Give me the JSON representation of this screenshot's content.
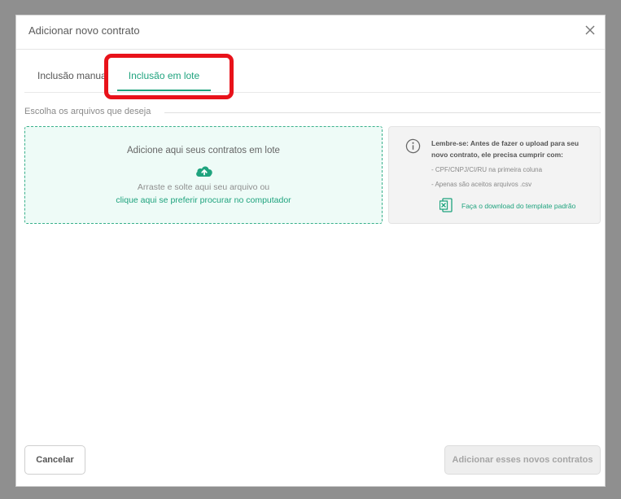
{
  "modal": {
    "title": "Adicionar novo contrato"
  },
  "tabs": [
    {
      "label": "Inclusão manual",
      "active": false
    },
    {
      "label": "Inclusão em lote",
      "active": true
    }
  ],
  "section": {
    "label": "Escolha os arquivos que deseja"
  },
  "dropzone": {
    "title": "Adicione aqui seus contratos em lote",
    "icon": "cloud-upload-icon",
    "subtitle": "Arraste e solte aqui seu arquivo ou",
    "link": "clique aqui se preferir procurar no computador"
  },
  "info": {
    "icon": "info-icon",
    "text": "Lembre-se: Antes de fazer o upload para seu novo contrato, ele precisa cumprir com:",
    "items": [
      "- CPF/CNPJ/CI/RU na primeira coluna",
      "- Apenas são aceitos arquivos .csv"
    ],
    "download_icon": "excel-icon",
    "download_link": "Faça o download do template padrão"
  },
  "footer": {
    "cancel_label": "Cancelar",
    "submit_label": "Adicionar esses novos contratos"
  },
  "colors": {
    "accent": "#1fa37e",
    "highlight": "#e8121a",
    "dropzone_bg": "#eefbf7"
  }
}
